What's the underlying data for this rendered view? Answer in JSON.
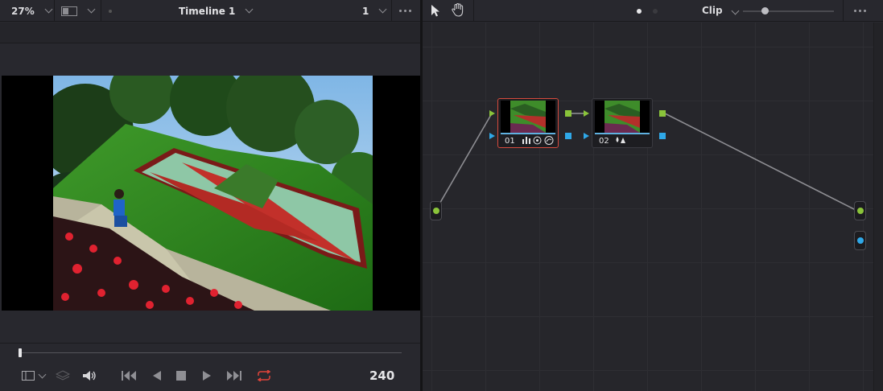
{
  "viewer": {
    "zoom": "27%",
    "timeline_name": "Timeline 1",
    "frame_number": "1",
    "timecode": "240",
    "scrub_position": 0.0
  },
  "node_editor": {
    "mode_label": "Clip",
    "nodes": [
      {
        "label": "01",
        "selected": true,
        "icons": [
          "bars-icon",
          "circle-icon",
          "curves-icon"
        ]
      },
      {
        "label": "02",
        "selected": false,
        "icons": [
          "drops-icon"
        ]
      }
    ]
  },
  "colors": {
    "accent_selected": "#d64a3d",
    "port_green": "#8ac43a",
    "port_blue": "#2fa8e8",
    "loop_active": "#e0443a"
  },
  "icons": {
    "toolbar": [
      "wipe-mode-icon",
      "pointer-icon",
      "hand-icon"
    ],
    "transport": [
      "viewer-layout-icon",
      "layers-icon",
      "volume-icon",
      "skip-start-icon",
      "play-reverse-icon",
      "stop-icon",
      "play-icon",
      "skip-end-icon",
      "loop-icon"
    ]
  }
}
